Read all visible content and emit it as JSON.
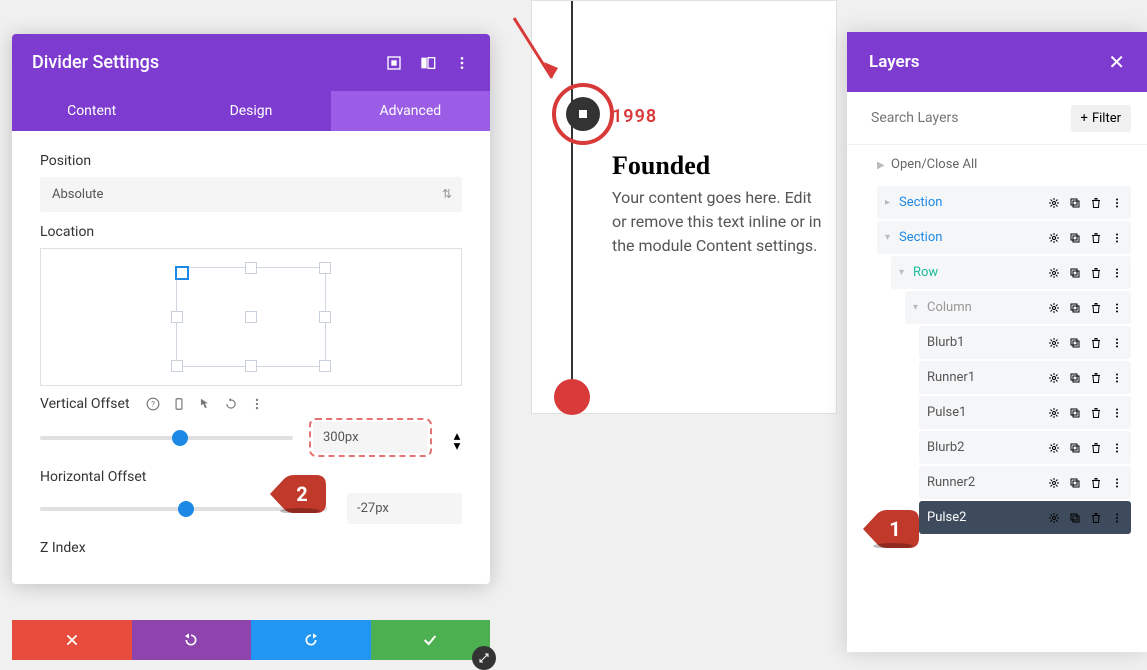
{
  "settings": {
    "title": "Divider Settings",
    "tabs": {
      "content": "Content",
      "design": "Design",
      "advanced": "Advanced"
    },
    "active_tab": "advanced",
    "position": {
      "label": "Position",
      "value": "Absolute"
    },
    "location": {
      "label": "Location",
      "selected_anchor": "top-left"
    },
    "vertical_offset": {
      "label": "Vertical Offset",
      "value": "300px",
      "slider_percent": 52
    },
    "horizontal_offset": {
      "label": "Horizontal Offset",
      "value": "-27px",
      "slider_percent": 48
    },
    "zindex": {
      "label": "Z Index"
    }
  },
  "content": {
    "year": "1998",
    "heading": "Founded",
    "body": "Your content goes here. Edit or remove this text inline or in the module Content settings."
  },
  "layers": {
    "title": "Layers",
    "search_placeholder": "Search Layers",
    "filter_label": "Filter",
    "open_close": "Open/Close All",
    "items": [
      {
        "name": "Section",
        "type": "section",
        "indent": 1,
        "expanded": false
      },
      {
        "name": "Section",
        "type": "section",
        "indent": 1,
        "expanded": true
      },
      {
        "name": "Row",
        "type": "row",
        "indent": 2,
        "expanded": true
      },
      {
        "name": "Column",
        "type": "column",
        "indent": 3,
        "expanded": true
      },
      {
        "name": "Blurb1",
        "type": "module",
        "indent": 4
      },
      {
        "name": "Runner1",
        "type": "module",
        "indent": 4
      },
      {
        "name": "Pulse1",
        "type": "module",
        "indent": 4
      },
      {
        "name": "Blurb2",
        "type": "module",
        "indent": 4
      },
      {
        "name": "Runner2",
        "type": "module",
        "indent": 4
      },
      {
        "name": "Pulse2",
        "type": "module",
        "indent": 4,
        "selected": true
      }
    ]
  },
  "annotations": {
    "badge_1": "1",
    "badge_2": "2"
  },
  "colors": {
    "accent": "#7e3bd0",
    "blue": "#1e88e5",
    "teal": "#1abc9c",
    "red": "#d83a3a"
  }
}
